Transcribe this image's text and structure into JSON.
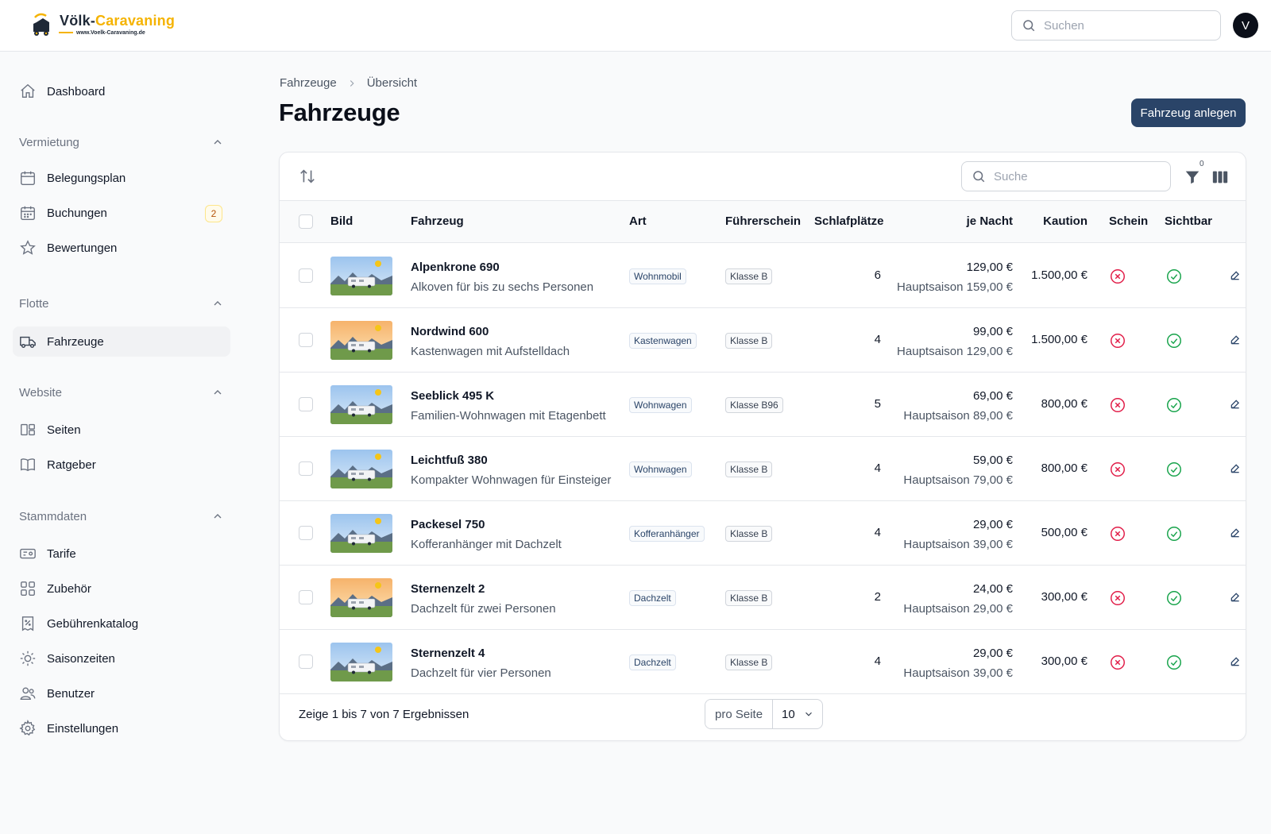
{
  "header": {
    "logo_brand_dark": "Völk-",
    "logo_brand_accent": "Caravaning",
    "logo_url": "www.Voelk-Caravaning.de",
    "search_placeholder": "Suchen",
    "avatar_initial": "V"
  },
  "sidebar": {
    "dashboard": "Dashboard",
    "groups": [
      {
        "title": "Vermietung",
        "items": [
          {
            "label": "Belegungsplan",
            "icon": "calendar-icon"
          },
          {
            "label": "Buchungen",
            "icon": "calendar-days-icon",
            "badge": "2"
          },
          {
            "label": "Bewertungen",
            "icon": "star-icon"
          }
        ]
      },
      {
        "title": "Flotte",
        "items": [
          {
            "label": "Fahrzeuge",
            "icon": "truck-icon",
            "active": true
          }
        ]
      },
      {
        "title": "Website",
        "items": [
          {
            "label": "Seiten",
            "icon": "layout-icon"
          },
          {
            "label": "Ratgeber",
            "icon": "book-icon"
          }
        ]
      },
      {
        "title": "Stammdaten",
        "items": [
          {
            "label": "Tarife",
            "icon": "ticket-icon"
          },
          {
            "label": "Zubehör",
            "icon": "grid-icon"
          },
          {
            "label": "Gebührenkatalog",
            "icon": "receipt-percent-icon"
          },
          {
            "label": "Saisonzeiten",
            "icon": "sun-icon"
          },
          {
            "label": "Benutzer",
            "icon": "users-icon"
          },
          {
            "label": "Einstellungen",
            "icon": "gear-icon"
          }
        ]
      }
    ]
  },
  "breadcrumb": {
    "parent": "Fahrzeuge",
    "current": "Übersicht"
  },
  "page": {
    "title": "Fahrzeuge",
    "create_button": "Fahrzeug anlegen"
  },
  "table": {
    "search_placeholder": "Suche",
    "filter_count": "0",
    "columns": {
      "bild": "Bild",
      "fahrzeug": "Fahrzeug",
      "art": "Art",
      "fuehrerschein": "Führerschein",
      "schlafplaetze": "Schlafplätze",
      "je_nacht": "je Nacht",
      "kaution": "Kaution",
      "schein": "Schein",
      "sichtbar": "Sichtbar"
    },
    "edit_label": "Bearbeiten",
    "rows": [
      {
        "name": "Alpenkrone 690",
        "desc": "Alkoven für bis zu sechs Personen",
        "art": "Wohnmobil",
        "license": "Klasse B",
        "sleeps": "6",
        "price": "129,00 €",
        "season": "Hauptsaison 159,00 €",
        "deposit": "1.500,00 €",
        "sky": "blue"
      },
      {
        "name": "Nordwind 600",
        "desc": "Kastenwagen mit Aufstelldach",
        "art": "Kastenwagen",
        "license": "Klasse B",
        "sleeps": "4",
        "price": "99,00 €",
        "season": "Hauptsaison 129,00 €",
        "deposit": "1.500,00 €",
        "sky": "orange"
      },
      {
        "name": "Seeblick 495 K",
        "desc": "Familien-Wohnwagen mit Etagenbett",
        "art": "Wohnwagen",
        "license": "Klasse B96",
        "sleeps": "5",
        "price": "69,00 €",
        "season": "Hauptsaison 89,00 €",
        "deposit": "800,00 €",
        "sky": "blue"
      },
      {
        "name": "Leichtfuß 380",
        "desc": "Kompakter Wohnwagen für Einsteiger",
        "art": "Wohnwagen",
        "license": "Klasse B",
        "sleeps": "4",
        "price": "59,00 €",
        "season": "Hauptsaison 79,00 €",
        "deposit": "800,00 €",
        "sky": "blue"
      },
      {
        "name": "Packesel 750",
        "desc": "Kofferanhänger mit Dachzelt",
        "art": "Kofferanhänger",
        "license": "Klasse B",
        "sleeps": "4",
        "price": "29,00 €",
        "season": "Hauptsaison 39,00 €",
        "deposit": "500,00 €",
        "sky": "blue"
      },
      {
        "name": "Sternenzelt 2",
        "desc": "Dachzelt für zwei Personen",
        "art": "Dachzelt",
        "license": "Klasse B",
        "sleeps": "2",
        "price": "24,00 €",
        "season": "Hauptsaison 29,00 €",
        "deposit": "300,00 €",
        "sky": "orange"
      },
      {
        "name": "Sternenzelt 4",
        "desc": "Dachzelt für vier Personen",
        "art": "Dachzelt",
        "license": "Klasse B",
        "sleeps": "4",
        "price": "29,00 €",
        "season": "Hauptsaison 39,00 €",
        "deposit": "300,00 €",
        "sky": "blue"
      }
    ],
    "footer": {
      "results": "Zeige 1 bis 7 von 7 Ergebnissen",
      "per_page_label": "pro Seite",
      "per_page_value": "10"
    }
  },
  "colors": {
    "accent": "#2a4468",
    "brand_yellow": "#f5b301",
    "danger": "#e11d48",
    "success": "#16a34a"
  }
}
